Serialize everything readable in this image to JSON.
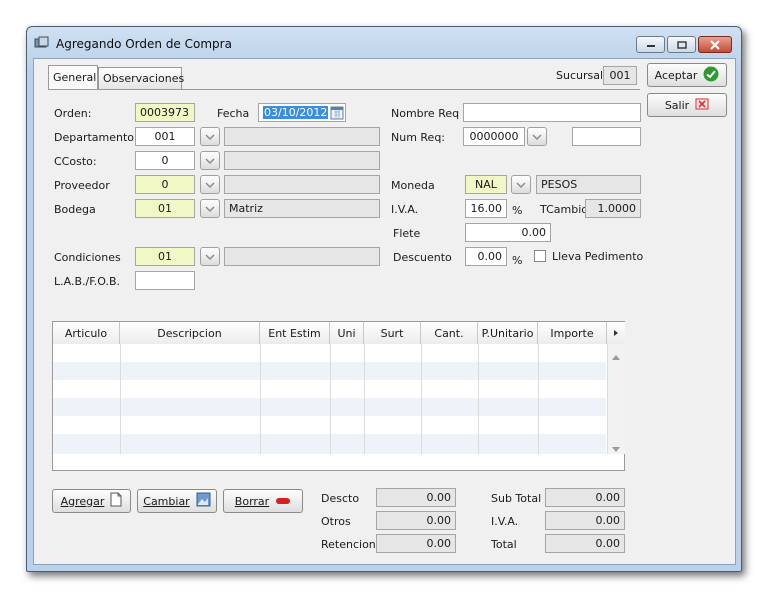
{
  "window": {
    "title": "Agregando Orden de Compra"
  },
  "tabs": [
    {
      "label": "General"
    },
    {
      "label": "Observaciones"
    }
  ],
  "sucursal": {
    "label": "Sucursal",
    "value": "001"
  },
  "actions": {
    "accept": "Aceptar",
    "exit": "Salir"
  },
  "form": {
    "orden": {
      "label": "Orden:",
      "value": "0003973"
    },
    "fecha": {
      "label": "Fecha",
      "value": "03/10/2012"
    },
    "departamento": {
      "label": "Departamento:",
      "value": "001",
      "desc": ""
    },
    "ccosto": {
      "label": "CCosto:",
      "value": "0",
      "desc": ""
    },
    "proveedor": {
      "label": "Proveedor",
      "value": "0",
      "desc": ""
    },
    "bodega": {
      "label": "Bodega",
      "value": "01",
      "desc": "Matriz"
    },
    "condiciones": {
      "label": "Condiciones",
      "value": "01",
      "desc": ""
    },
    "lab_fob": {
      "label": "L.A.B./F.O.B.",
      "value": ""
    },
    "nombre_req": {
      "label": "Nombre Req",
      "value": ""
    },
    "num_req": {
      "label": "Num Req:",
      "value": "0000000",
      "extra": ""
    },
    "moneda": {
      "label": "Moneda",
      "value": "NAL",
      "desc": "PESOS"
    },
    "iva": {
      "label": "I.V.A.",
      "value": "16.00",
      "unit": "%"
    },
    "tcambio": {
      "label": "TCambio",
      "value": "1.0000"
    },
    "flete": {
      "label": "Flete",
      "value": "0.00"
    },
    "descuento": {
      "label": "Descuento",
      "value": "0.00",
      "unit": "%"
    },
    "lleva_pedimento": {
      "label": "Lleva Pedimento",
      "checked": false
    }
  },
  "grid": {
    "columns": [
      "Articulo",
      "Descripcion",
      "Ent Estim",
      "Uni",
      "Surt",
      "Cant.",
      "P.Unitario",
      "Importe"
    ],
    "rows": []
  },
  "buttons": {
    "agregar": "Agregar",
    "cambiar": "Cambiar",
    "borrar": "Borrar"
  },
  "totals_left": [
    {
      "label": "Descto",
      "value": "0.00"
    },
    {
      "label": "Otros",
      "value": "0.00"
    },
    {
      "label": "Retencion",
      "value": "0.00"
    }
  ],
  "totals_right": [
    {
      "label": "Sub Total",
      "value": "0.00"
    },
    {
      "label": "I.V.A.",
      "value": "0.00"
    },
    {
      "label": "Total",
      "value": "0.00"
    }
  ],
  "colors": {
    "required_field": "#f1f8c6",
    "readonly_field": "#e6e6e6",
    "selection": "#3b8de0"
  }
}
